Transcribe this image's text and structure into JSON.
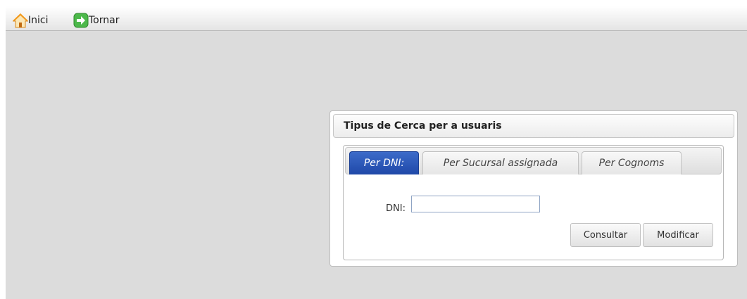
{
  "toolbar": {
    "home_label": "Inici",
    "back_label": "Tornar",
    "home_icon": "home-icon",
    "back_icon": "arrow-right-icon"
  },
  "panel": {
    "title": "Tipus de Cerca per a usuaris",
    "tabs": [
      {
        "label": "Per DNI:",
        "active": true
      },
      {
        "label": "Per Sucursal assignada",
        "active": false
      },
      {
        "label": "Per Cognoms",
        "active": false
      }
    ],
    "dni": {
      "label": "DNI:",
      "value": "",
      "placeholder": ""
    },
    "buttons": {
      "consultar": "Consultar",
      "modificar": "Modificar"
    }
  },
  "colors": {
    "active_tab": "#2a55b8",
    "background": "#dcdcdc",
    "home_roof": "#f29a1e",
    "back_icon": "#4cb84a"
  }
}
